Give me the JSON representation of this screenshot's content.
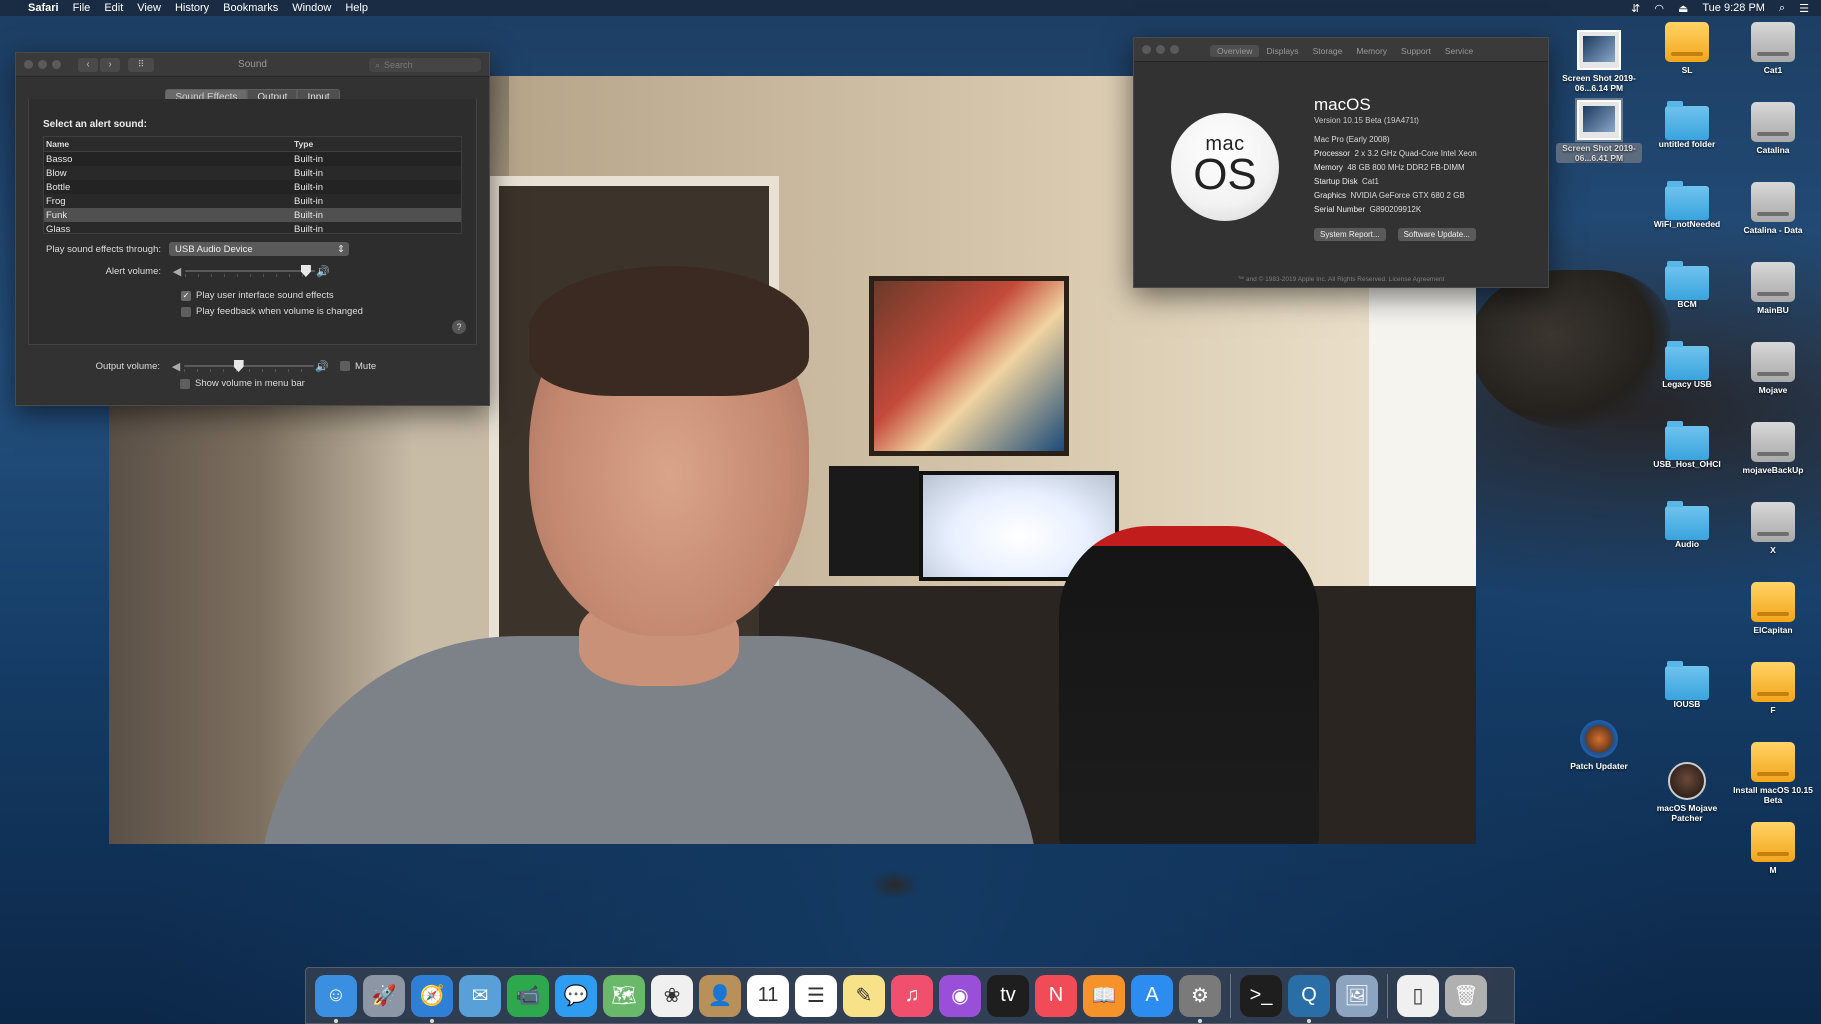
{
  "menubar": {
    "apple_glyph": "",
    "items": [
      "Safari",
      "File",
      "Edit",
      "View",
      "History",
      "Bookmarks",
      "Window",
      "Help"
    ],
    "clock": "Tue 9:28 PM"
  },
  "sound_window": {
    "title": "Sound",
    "search_placeholder": "Search",
    "tabs": [
      "Sound Effects",
      "Output",
      "Input"
    ],
    "alert_title": "Select an alert sound:",
    "table_headers": {
      "name": "Name",
      "type": "Type"
    },
    "sounds": [
      {
        "name": "Basso",
        "type": "Built-in"
      },
      {
        "name": "Blow",
        "type": "Built-in"
      },
      {
        "name": "Bottle",
        "type": "Built-in"
      },
      {
        "name": "Frog",
        "type": "Built-in"
      },
      {
        "name": "Funk",
        "type": "Built-in"
      },
      {
        "name": "Glass",
        "type": "Built-in"
      }
    ],
    "selected_sound": "Funk",
    "play_through_label": "Play sound effects through:",
    "play_through_value": "USB Audio Device",
    "alert_volume_label": "Alert volume:",
    "alert_volume_level": 0.93,
    "ui_sounds_label": "Play user interface sound effects",
    "ui_sounds_checked": true,
    "feedback_label": "Play feedback when volume is changed",
    "feedback_checked": false,
    "output_volume_label": "Output volume:",
    "output_volume_level": 0.42,
    "mute_label": "Mute",
    "show_volume_label": "Show volume in menu bar",
    "help_glyph": "?"
  },
  "about_window": {
    "tabs": [
      "Overview",
      "Displays",
      "Storage",
      "Memory",
      "Support",
      "Service"
    ],
    "logo_mac": "mac",
    "logo_os": "OS",
    "os_name": "macOS",
    "version": "Version 10.15 Beta (19A471t)",
    "specs": [
      {
        "label": "Mac Pro (Early 2008)",
        "value": ""
      },
      {
        "label": "Processor",
        "value": "2 x 3.2 GHz Quad-Core Intel Xeon"
      },
      {
        "label": "Memory",
        "value": "48 GB 800 MHz DDR2 FB-DIMM"
      },
      {
        "label": "Startup Disk",
        "value": "Cat1"
      },
      {
        "label": "Graphics",
        "value": "NVIDIA GeForce GTX 680 2 GB"
      },
      {
        "label": "Serial Number",
        "value": "G890209912K"
      }
    ],
    "buttons": [
      "System Report...",
      "Software Update..."
    ],
    "footer": "™ and © 1983-2019 Apple Inc. All Rights Reserved. License Agreement"
  },
  "desktop_icons": {
    "col1": [
      {
        "label": "Screen Shot 2019-06...6.14 PM",
        "kind": "screenshot",
        "selected": false
      },
      {
        "label": "Screen Shot 2019-06...6.41 PM",
        "kind": "screenshot",
        "selected": true
      },
      {
        "label": "Patch Updater",
        "kind": "app"
      }
    ],
    "col2": [
      {
        "label": "SL",
        "kind": "external"
      },
      {
        "label": "untitled folder",
        "kind": "folder"
      },
      {
        "label": "WiFi_notNeeded",
        "kind": "folder"
      },
      {
        "label": "BCM",
        "kind": "folder"
      },
      {
        "label": "Legacy USB",
        "kind": "folder"
      },
      {
        "label": "USB_Host_OHCI",
        "kind": "folder"
      },
      {
        "label": "Audio",
        "kind": "folder"
      },
      {
        "label": "IOUSB",
        "kind": "folder"
      },
      {
        "label": "macOS Mojave Patcher",
        "kind": "app"
      }
    ],
    "col3": [
      {
        "label": "Cat1",
        "kind": "drive"
      },
      {
        "label": "Catalina",
        "kind": "drive"
      },
      {
        "label": "Catalina - Data",
        "kind": "drive"
      },
      {
        "label": "MainBU",
        "kind": "drive"
      },
      {
        "label": "Mojave",
        "kind": "drive"
      },
      {
        "label": "mojaveBackUp",
        "kind": "drive"
      },
      {
        "label": "X",
        "kind": "drive"
      },
      {
        "label": "ElCapitan",
        "kind": "external"
      },
      {
        "label": "F",
        "kind": "external"
      },
      {
        "label": "Install macOS 10.15 Beta",
        "kind": "external"
      },
      {
        "label": "M",
        "kind": "external"
      }
    ]
  },
  "dock": {
    "apps": [
      {
        "name": "finder-icon",
        "glyph": "☺",
        "color": "#3b8fe0",
        "running": true
      },
      {
        "name": "launchpad-icon",
        "glyph": "🚀",
        "color": "#8c96a4",
        "running": false
      },
      {
        "name": "safari-icon",
        "glyph": "🧭",
        "color": "#2f7fd6",
        "running": true
      },
      {
        "name": "mail-icon",
        "glyph": "✉",
        "color": "#5aa0d8",
        "running": false
      },
      {
        "name": "facetime-icon",
        "glyph": "📹",
        "color": "#2ea84d",
        "running": false
      },
      {
        "name": "messages-icon",
        "glyph": "💬",
        "color": "#2e9cf0",
        "running": false
      },
      {
        "name": "maps-icon",
        "glyph": "🗺",
        "color": "#6ab86a",
        "running": false
      },
      {
        "name": "photos-icon",
        "glyph": "❀",
        "color": "#f0f0f0",
        "running": false
      },
      {
        "name": "contacts-icon",
        "glyph": "👤",
        "color": "#b8905a",
        "running": false
      },
      {
        "name": "calendar-icon",
        "glyph": "11",
        "color": "#ffffff",
        "running": false
      },
      {
        "name": "reminders-icon",
        "glyph": "☰",
        "color": "#ffffff",
        "running": false
      },
      {
        "name": "notes-icon",
        "glyph": "✎",
        "color": "#f7e28a",
        "running": false
      },
      {
        "name": "music-icon",
        "glyph": "♫",
        "color": "#f0506e",
        "running": false
      },
      {
        "name": "podcasts-icon",
        "glyph": "◉",
        "color": "#9a4fd8",
        "running": false
      },
      {
        "name": "tv-icon",
        "glyph": "tv",
        "color": "#1e1e1e",
        "running": false
      },
      {
        "name": "news-icon",
        "glyph": "N",
        "color": "#f24b58",
        "running": false
      },
      {
        "name": "books-icon",
        "glyph": "📖",
        "color": "#f5932a",
        "running": false
      },
      {
        "name": "app-store-icon",
        "glyph": "A",
        "color": "#2d8cf0",
        "running": false
      },
      {
        "name": "system-preferences-icon",
        "glyph": "⚙",
        "color": "#7a7a7a",
        "running": true
      }
    ],
    "apps2": [
      {
        "name": "terminal-icon",
        "glyph": ">_",
        "color": "#1e1e1e",
        "running": false
      },
      {
        "name": "quicktime-icon",
        "glyph": "Q",
        "color": "#2a6ea8",
        "running": true
      },
      {
        "name": "preview-icon",
        "glyph": "🖼",
        "color": "#8ca4c0",
        "running": false
      }
    ],
    "apps3": [
      {
        "name": "document-icon",
        "glyph": "▯",
        "color": "#f0f0f0",
        "running": false
      },
      {
        "name": "trash-icon",
        "glyph": "🗑",
        "color": "#b0b0b0",
        "running": false
      }
    ]
  }
}
